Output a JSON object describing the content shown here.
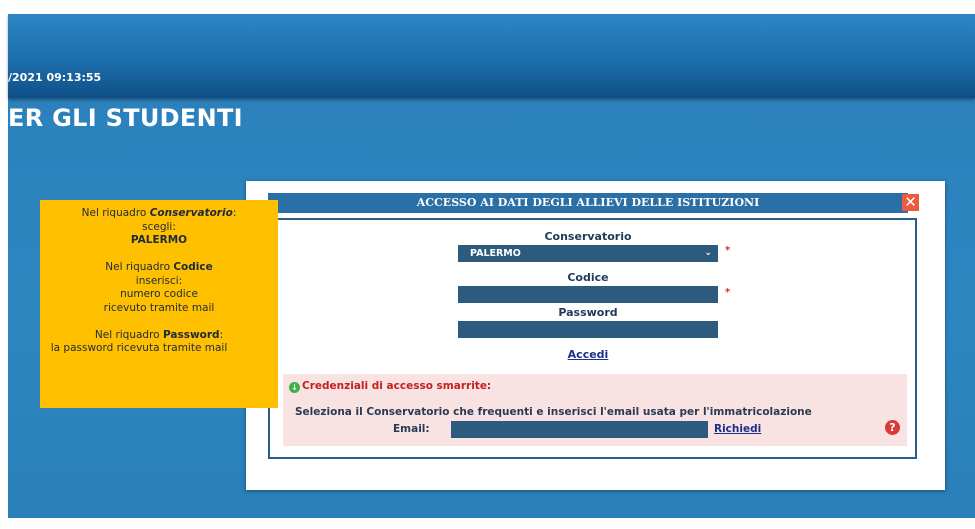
{
  "header": {
    "datetime": "/2021 09:13:55",
    "heading": "ER GLI STUDENTI"
  },
  "note": {
    "line1_pre": "Nel riquadro ",
    "line1_bold": "Conservatorio",
    "line1_post": ":",
    "line2": "scegli:",
    "line3": "PALERMO",
    "line4_pre": "Nel riquadro ",
    "line4_bold": "Codice",
    "line5": "inserisci:",
    "line6": "numero codice",
    "line7": "ricevuto tramite mail",
    "line8_pre": "Nel riquadro ",
    "line8_bold": "Password",
    "line8_post": ":",
    "line9": "la password ricevuta tramite mail"
  },
  "dialog": {
    "title": "ACCESSO AI DATI DEGLI ALLIEVI DELLE ISTITUZIONI",
    "close_symbol": "✕",
    "conservatorio_label": "Conservatorio",
    "conservatorio_value": "PALERMO",
    "codice_label": "Codice",
    "password_label": "Password",
    "required_mark": "*",
    "login_link": "Accedi",
    "recovery": {
      "title": "Credenziali di accesso smarrite:",
      "description": "Seleziona il Conservatorio che frequenti e inserisci l'email usata per l'immatricolazione",
      "email_label": "Email:",
      "request_link": "Richiedi",
      "help_symbol": "?"
    }
  },
  "colors": {
    "background": "#2e86c1",
    "note_bg": "#ffc000",
    "field_bg": "#2c5b7e",
    "title_bar": "#2a6fa5",
    "recovery_bg": "#f8e2e2"
  }
}
